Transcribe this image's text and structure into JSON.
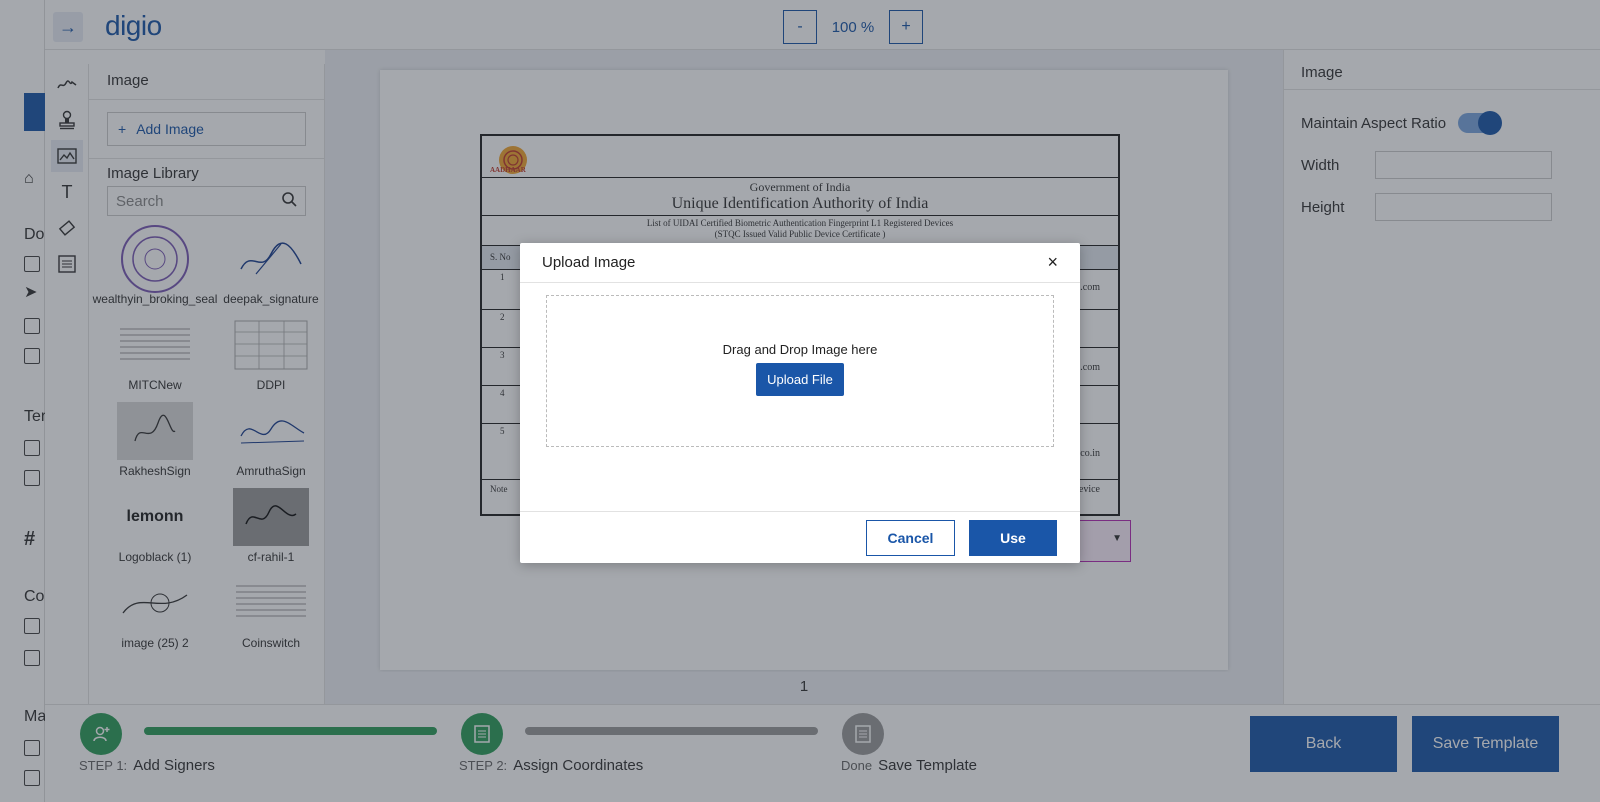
{
  "app": {
    "logo": "digio",
    "collapse_icon": "arrow-right-icon"
  },
  "zoom": {
    "minus": "-",
    "value": "100 %",
    "plus": "+"
  },
  "left_fragments": [
    "Do",
    "Ter",
    "#",
    "Co",
    "Ma"
  ],
  "tools": [
    "signature-icon",
    "stamp-icon",
    "image-icon",
    "text-icon",
    "eraser-icon",
    "list-icon"
  ],
  "image_panel": {
    "title": "Image",
    "add_image": "Add Image",
    "library_title": "Image Library",
    "search_placeholder": "Search",
    "items": [
      {
        "name": "wealthyin_broking_seal"
      },
      {
        "name": "deepak_signature"
      },
      {
        "name": "MITCNew"
      },
      {
        "name": "DDPI"
      },
      {
        "name": "RakheshSign"
      },
      {
        "name": "AmruthaSign"
      },
      {
        "name": "Logoblack (1)"
      },
      {
        "name": "cf-rahil-1"
      },
      {
        "name": "image (25) 2"
      },
      {
        "name": "Coinswitch"
      }
    ]
  },
  "document": {
    "logo_text": "AADHAAR",
    "line1": "Government of India",
    "line2": "Unique Identification Authority of  India",
    "small1": "List of UIDAI Certified Biometric Authentication Fingerprint L1 Registered Devices",
    "small2": "(STQC Issued  Valid Public Device Certificate )",
    "col_header": "S. No",
    "row_numbers": [
      "1",
      "2",
      "3",
      "4",
      "5"
    ],
    "right_fragments": [
      "demia.com",
      "cc.com",
      "sonit.co.in",
      "ublic Device"
    ],
    "note": "Note",
    "page_number": "1",
    "field_value": "1"
  },
  "properties": {
    "title": "Image",
    "aspect_label": "Maintain Aspect Ratio",
    "aspect_on": true,
    "width_label": "Width",
    "height_label": "Height"
  },
  "steps": [
    {
      "num": "STEP 1:",
      "label": "Add Signers",
      "color": "#2e9e5b"
    },
    {
      "num": "STEP 2:",
      "label": "Assign Coordinates",
      "color": "#2e9e5b"
    },
    {
      "num": "Done",
      "label": "Save Template",
      "color": "#9a9a9a"
    }
  ],
  "buttons": {
    "back": "Back",
    "save_template": "Save Template"
  },
  "modal": {
    "title": "Upload Image",
    "close": "×",
    "drop_text": "Drag and Drop Image here",
    "upload_button": "Upload File",
    "cancel": "Cancel",
    "use": "Use"
  },
  "colors": {
    "accent": "#1a56a8",
    "step_done": "#2e9e5b",
    "step_pending": "#9a9a9a"
  }
}
